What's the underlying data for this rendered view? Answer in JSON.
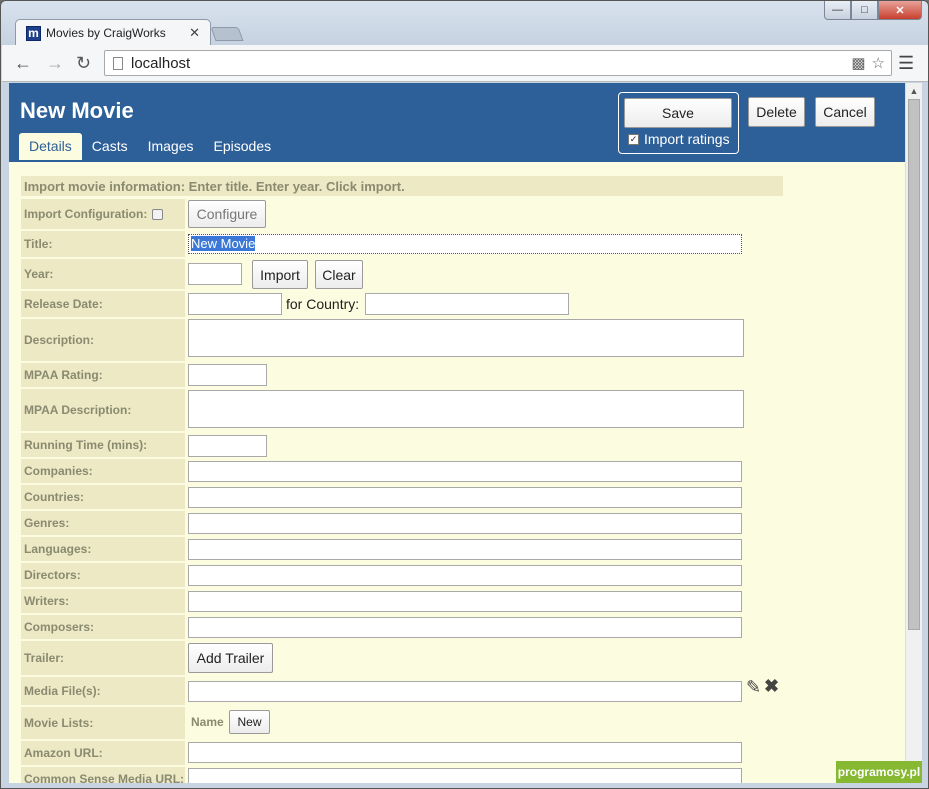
{
  "browser": {
    "tab_title": "Movies by CraigWorks",
    "favicon_letter": "m",
    "url": "localhost"
  },
  "header": {
    "title": "New Movie",
    "tabs": [
      "Details",
      "Casts",
      "Images",
      "Episodes"
    ],
    "save_label": "Save",
    "import_ratings_label": "Import ratings",
    "delete_label": "Delete",
    "cancel_label": "Cancel"
  },
  "form": {
    "info": "Import movie information: Enter title. Enter year. Click import.",
    "import_config_label": "Import Configuration:",
    "configure_label": "Configure",
    "title_label": "Title:",
    "title_value": "New Movie",
    "year_label": "Year:",
    "import_label": "Import",
    "clear_label": "Clear",
    "release_date_label": "Release Date:",
    "for_country_label": "for Country:",
    "description_label": "Description:",
    "mpaa_rating_label": "MPAA Rating:",
    "mpaa_description_label": "MPAA Description:",
    "running_time_label": "Running Time (mins):",
    "companies_label": "Companies:",
    "countries_label": "Countries:",
    "genres_label": "Genres:",
    "languages_label": "Languages:",
    "directors_label": "Directors:",
    "writers_label": "Writers:",
    "composers_label": "Composers:",
    "trailer_label": "Trailer:",
    "add_trailer_label": "Add Trailer",
    "media_files_label": "Media File(s):",
    "movie_lists_label": "Movie Lists:",
    "name_label": "Name",
    "new_label": "New",
    "amazon_url_label": "Amazon URL:",
    "common_sense_label": "Common Sense Media URL:"
  },
  "watermark": "programosy.pl"
}
